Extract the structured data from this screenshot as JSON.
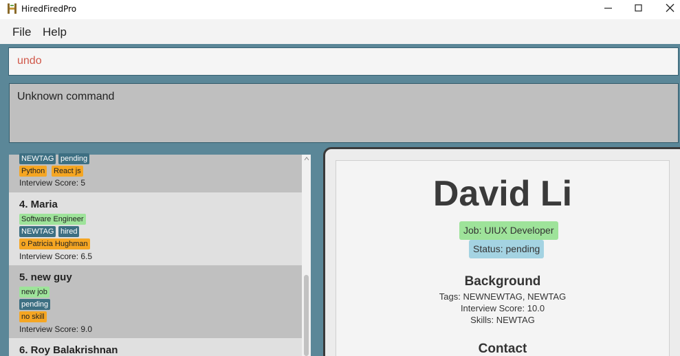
{
  "window": {
    "title": "HiredFiredPro"
  },
  "menu": {
    "file": "File",
    "help": "Help"
  },
  "command": {
    "value": "undo"
  },
  "result": {
    "text": "Unknown command"
  },
  "list": {
    "card3": {
      "tags": [
        "NEWTAG",
        "pending",
        "Python",
        "React js"
      ],
      "score": "Interview Score: 5"
    },
    "card4": {
      "name": "4. Maria",
      "job": "Software Engineer",
      "tags": [
        "NEWTAG",
        "hired",
        "o Patricia Hughman"
      ],
      "score": "Interview Score: 6.5"
    },
    "card5": {
      "name": "5. new guy",
      "job": "new job",
      "status": "pending",
      "skill": "no skill",
      "score": "Interview Score: 9.0"
    },
    "card6": {
      "name": "6. Roy Balakrishnan"
    }
  },
  "detail": {
    "name": "David Li",
    "job": "Job: UIUX Developer",
    "status": "Status: pending",
    "background_title": "Background",
    "tags": "Tags: NEWNEWTAG, NEWTAG",
    "score": "Interview Score: 10.0",
    "skills": "Skills: NEWTAG",
    "contact_title": "Contact"
  },
  "colors": {
    "accent": "#5b8798",
    "tag_blue": "#3d6f82",
    "tag_green": "#9ee39a",
    "tag_orange": "#f5a623",
    "status_blue": "#a4d3e2",
    "command_text": "#d0584a"
  }
}
